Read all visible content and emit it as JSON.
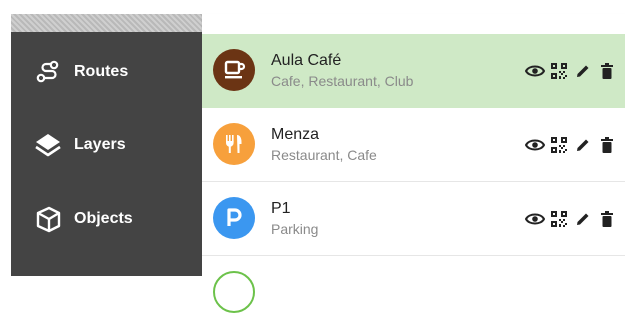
{
  "sidebar": {
    "items": [
      {
        "label": "Routes",
        "icon": "route-icon"
      },
      {
        "label": "Layers",
        "icon": "layers-icon"
      },
      {
        "label": "Objects",
        "icon": "objects-icon"
      }
    ]
  },
  "places": [
    {
      "title": "Aula Café",
      "subtitle": "Cafe, Restaurant, Club",
      "icon": "coffee-icon",
      "color": "#6b3414",
      "selected": true
    },
    {
      "title": "Menza",
      "subtitle": "Restaurant, Cafe",
      "icon": "restaurant-icon",
      "color": "#f7a03c",
      "selected": false
    },
    {
      "title": "P1",
      "subtitle": "Parking",
      "icon": "parking-icon",
      "color": "#3b97f0",
      "selected": false
    }
  ],
  "colors": {
    "sidebar_bg": "#444444",
    "selected_row": "#cfe9c6",
    "partial_avatar_border": "#6cc24a"
  }
}
